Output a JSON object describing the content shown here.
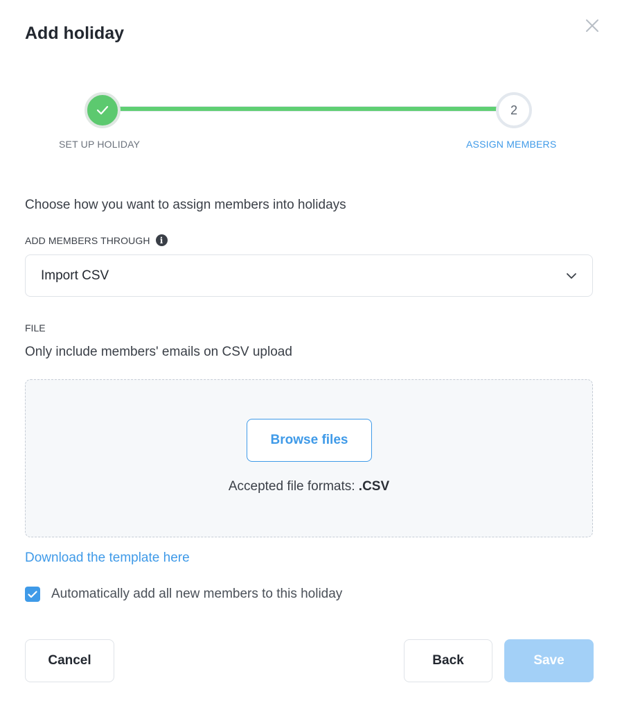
{
  "dialog": {
    "title": "Add holiday",
    "close_icon": "close-icon"
  },
  "stepper": {
    "progress": 1.0,
    "steps": [
      {
        "label": "SET UP HOLIDAY",
        "state": "completed",
        "icon": "check-icon"
      },
      {
        "label": "ASSIGN MEMBERS",
        "number": "2",
        "state": "active"
      }
    ],
    "colors": {
      "completed": "#5cc96f",
      "active_label": "#3f9ae8"
    }
  },
  "assign": {
    "instructions": "Choose how you want to assign members into holidays",
    "field_label": "ADD MEMBERS THROUGH",
    "info_icon": "info-icon",
    "selected_option": "Import CSV"
  },
  "file": {
    "label": "FILE",
    "help_text": "Only include members' emails on CSV upload",
    "browse_label": "Browse files",
    "formats_prefix": "Accepted file formats: ",
    "formats_value": ".CSV"
  },
  "template_link": "Download the template here",
  "auto_add": {
    "checked": true,
    "label": "Automatically add all new members to this holiday"
  },
  "footer": {
    "cancel_label": "Cancel",
    "back_label": "Back",
    "save_label": "Save"
  },
  "colors": {
    "accent": "#3f9ae8",
    "success": "#5cc96f",
    "save_disabled": "#a3d0f7"
  }
}
